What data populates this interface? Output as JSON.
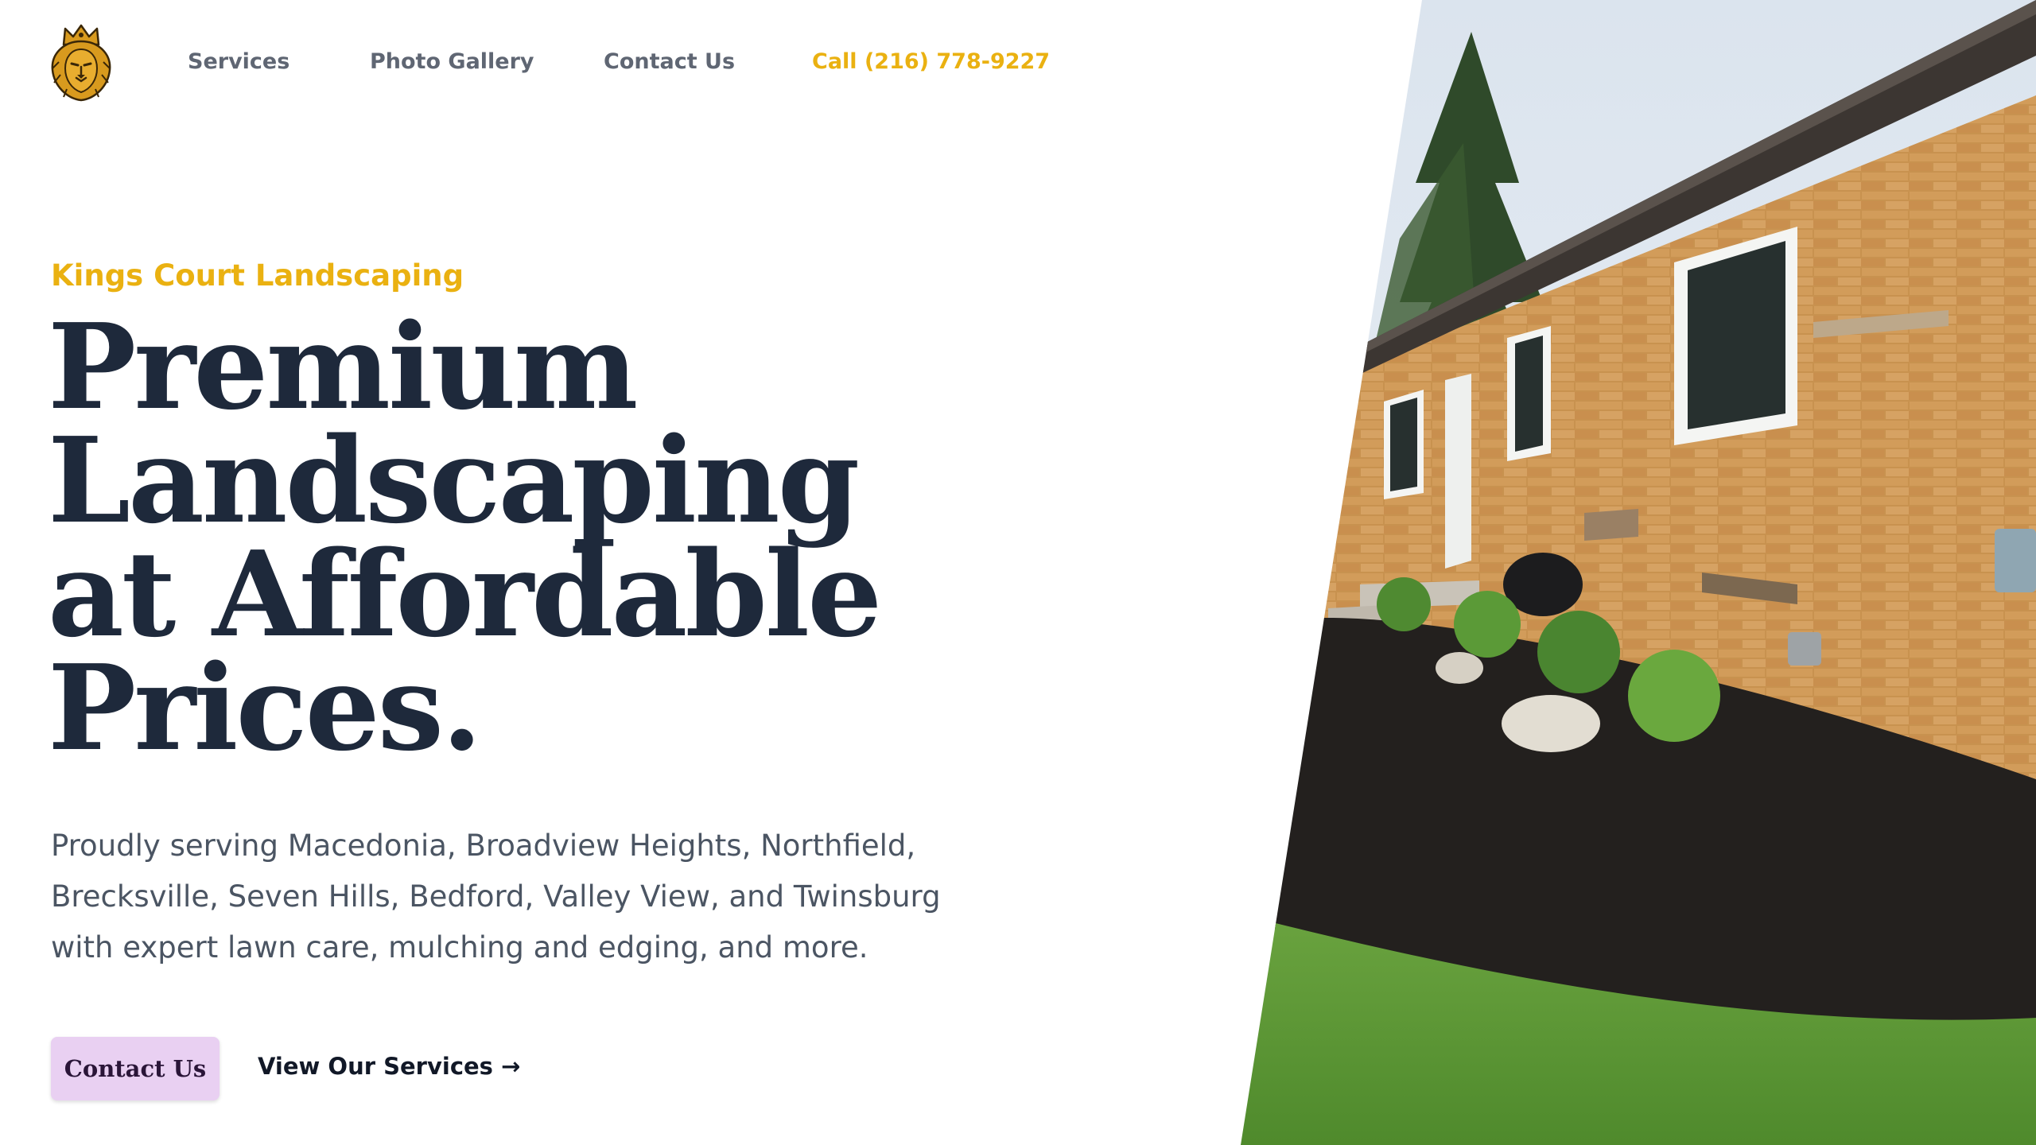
{
  "brand": {
    "logo_icon": "lion-crown-icon",
    "logo_colors": {
      "gold": "#d89a1e",
      "dark": "#3a2708"
    }
  },
  "nav": {
    "items": [
      {
        "label": "Services"
      },
      {
        "label": "Photo Gallery"
      },
      {
        "label": "Contact Us"
      }
    ],
    "call_label": "Call (216) 778-9227"
  },
  "hero": {
    "eyebrow": "Kings Court Landscaping",
    "headline": "Premium Landscaping at Affordable Prices.",
    "description": "Proudly serving Macedonia, Broadview Heights, Northfield, Brecksville, Seven Hills, Bedford, Valley View, and Twinsburg with expert lawn care, mulching and edging, and more.",
    "primary_button": "Contact Us",
    "secondary_link": "View Our Services →"
  },
  "colors": {
    "accent_gold": "#eab111",
    "heading": "#1e293b",
    "body_text": "#4b5563",
    "nav_text": "#5f6673",
    "button_bg": "#e9d0f2",
    "button_text": "#2a1538"
  }
}
